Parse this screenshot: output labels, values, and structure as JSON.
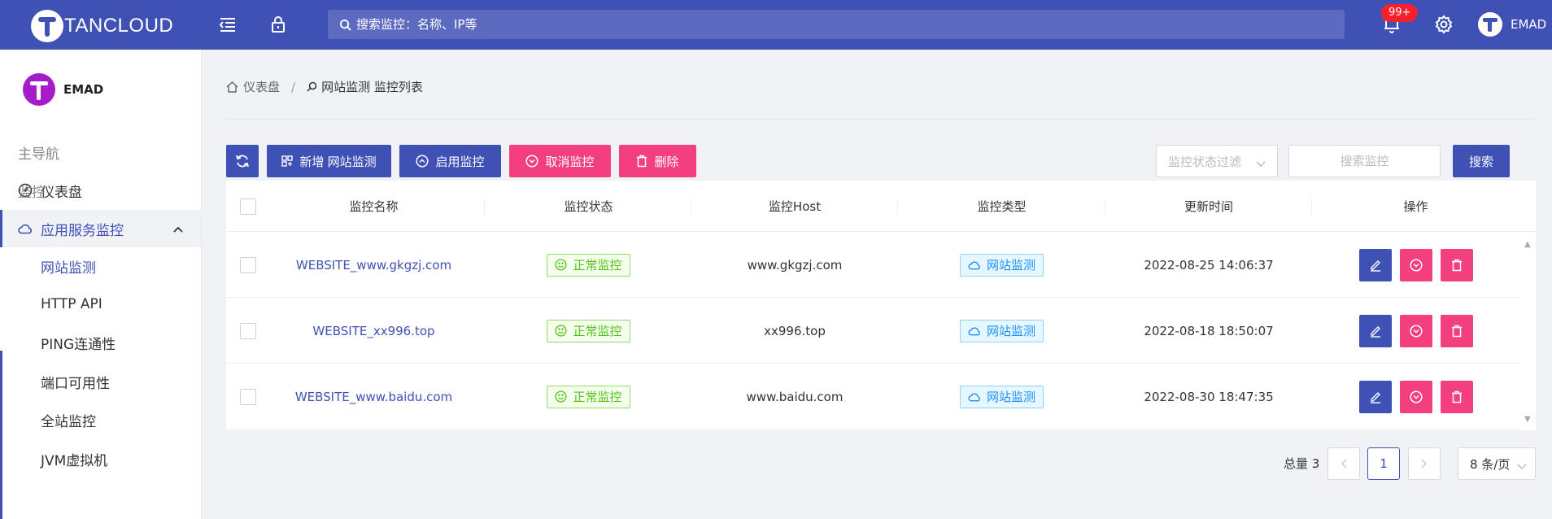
{
  "header": {
    "logo_text": "TANCLOUD",
    "search_placeholder": "搜索监控：名称、IP等",
    "notification_count": "99+",
    "user_name": "EMAD"
  },
  "sidebar": {
    "user_name": "EMAD",
    "groups": [
      "主导航",
      "监控"
    ],
    "dashboard_label": "仪表盘",
    "parent_label": "应用服务监控",
    "sub_items": [
      "网站监测",
      "HTTP API",
      "PING连通性",
      "端口可用性",
      "全站监控",
      "JVM虚拟机"
    ]
  },
  "breadcrumb": {
    "home": "仪表盘",
    "current": "网站监测 监控列表"
  },
  "toolbar": {
    "add_label": "新增 网站监测",
    "enable_label": "启用监控",
    "cancel_label": "取消监控",
    "delete_label": "删除",
    "filter_placeholder": "监控状态过滤",
    "search_placeholder": "搜索监控",
    "search_button": "搜索"
  },
  "table": {
    "columns": [
      "监控名称",
      "监控状态",
      "监控Host",
      "监控类型",
      "更新时间",
      "操作"
    ],
    "rows": [
      {
        "name": "WEBSITE_www.gkgzj.com",
        "status": "正常监控",
        "host": "www.gkgzj.com",
        "type": "网站监测",
        "updated": "2022-08-25 14:06:37"
      },
      {
        "name": "WEBSITE_xx996.top",
        "status": "正常监控",
        "host": "xx996.top",
        "type": "网站监测",
        "updated": "2022-08-18 18:50:07"
      },
      {
        "name": "WEBSITE_www.baidu.com",
        "status": "正常监控",
        "host": "www.baidu.com",
        "type": "网站监测",
        "updated": "2022-08-30 18:47:35"
      }
    ]
  },
  "pagination": {
    "total_label": "总量 3",
    "current_page": "1",
    "page_size": "8 条/页"
  },
  "colors": {
    "primary": "#3f51b5",
    "danger": "#f43f7f",
    "success": "#52c41a",
    "info": "#1890ff"
  }
}
